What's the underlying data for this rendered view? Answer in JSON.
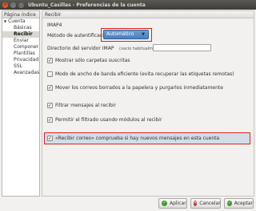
{
  "window": {
    "title": "Ubuntu_Casillas - Preferencias de la cuenta"
  },
  "sidebar": {
    "header": "Página índice",
    "root": "Cuenta",
    "items": [
      "Básicas",
      "Recibir",
      "Enviar",
      "Componer",
      "Plantillas",
      "Privacidad",
      "SSL",
      "Avanzadas"
    ],
    "selected": "Recibir"
  },
  "content": {
    "header": "Recibir",
    "protocol": "IMAP4",
    "auth_label": "Método de autentificación",
    "auth_value": "Automático",
    "imap_dir_label": "Directorio del servidor IMAP",
    "imap_dir_hint": "(vacío habitualmente)",
    "imap_dir_value": "",
    "options": [
      {
        "label": "Mostrar sólo carpetas suscritas",
        "checked": true
      },
      {
        "label": "Modo de ancho de banda eficiente (evita recuperar las etiquetas remotas)",
        "checked": false
      },
      {
        "label": "Mover los correos borrados a la papelera y purgarlos inmediatamente",
        "checked": true
      },
      {
        "label": "Filtrar mensajes al recibir",
        "checked": true
      },
      {
        "label": "Permitir el filtrado usando módulos al recibir",
        "checked": true
      },
      {
        "label": "«Recibir correo» comprueba si hay nuevos mensajes en esta cuenta",
        "checked": true
      }
    ]
  },
  "buttons": {
    "apply": "Aplicar",
    "cancel": "Cancelar",
    "accept": "Aceptar"
  },
  "colors": {
    "highlight": "#d9231f",
    "combo": "#4a7fc0",
    "title_bar": "#3c3b37"
  }
}
